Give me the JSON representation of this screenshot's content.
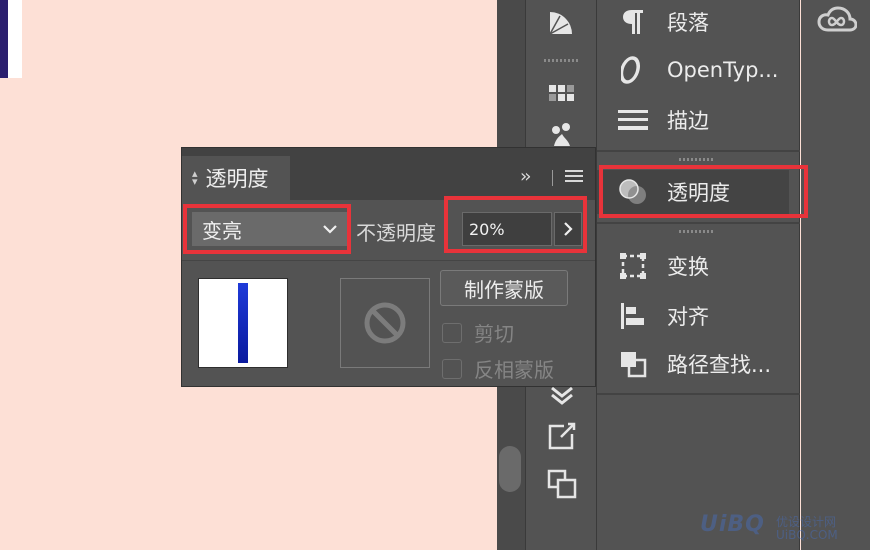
{
  "float_panel": {
    "tab_label": "透明度",
    "blend_mode": "变亮",
    "opacity_label": "不透明度",
    "opacity_value": "20%",
    "make_mask_label": "制作蒙版",
    "clip_label": "剪切",
    "invert_mask_label": "反相蒙版",
    "clip_checked": false,
    "invert_checked": false
  },
  "panel_list": {
    "items": [
      {
        "label": "段落",
        "icon": "paragraph-icon"
      },
      {
        "label": "OpenTyp...",
        "icon": "opentype-icon"
      },
      {
        "label": "描边",
        "icon": "stroke-icon"
      },
      {
        "label": "透明度",
        "icon": "transparency-icon",
        "active": true
      },
      {
        "label": "变换",
        "icon": "transform-icon"
      },
      {
        "label": "对齐",
        "icon": "align-icon"
      },
      {
        "label": "路径查找...",
        "icon": "pathfinder-icon"
      }
    ]
  },
  "toolstrip": {
    "icons": [
      "gradient-fan-icon",
      "swatches-grid-icon",
      "symbols-icon",
      "layers-chevron-icon",
      "export-icon",
      "artboards-icon"
    ]
  },
  "colors": {
    "canvas": "#fde0d6",
    "panel": "#535353",
    "highlight": "#e8333a"
  },
  "watermark": {
    "text": "UiBQ",
    "sub1": "优设设计网",
    "sub2": "UiBQ.COM"
  }
}
